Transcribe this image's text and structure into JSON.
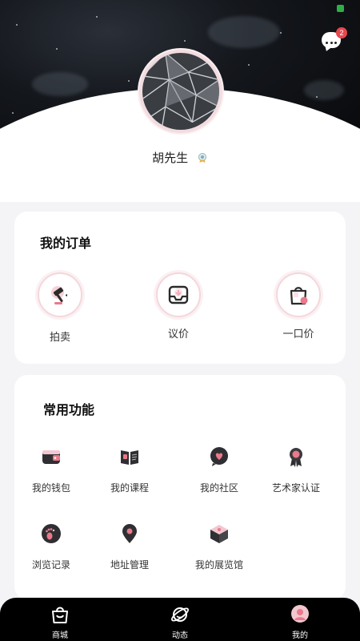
{
  "profile": {
    "name": "胡先生",
    "message_badge_count": "2"
  },
  "orders": {
    "title": "我的订单",
    "items": [
      {
        "label": "拍卖",
        "icon": "auction-gavel-icon"
      },
      {
        "label": "议价",
        "icon": "bargain-inbox-icon"
      },
      {
        "label": "一口价",
        "icon": "fixed-price-bag-icon"
      }
    ]
  },
  "functions": {
    "title": "常用功能",
    "items": [
      {
        "label": "我的钱包",
        "icon": "wallet-icon"
      },
      {
        "label": "我的课程",
        "icon": "book-icon"
      },
      {
        "label": "我的社区",
        "icon": "heart-chat-icon"
      },
      {
        "label": "艺术家认证",
        "icon": "award-medal-icon"
      },
      {
        "label": "浏览记录",
        "icon": "footprint-icon"
      },
      {
        "label": "地址管理",
        "icon": "location-pin-icon"
      },
      {
        "label": "我的展览馆",
        "icon": "cube-icon"
      }
    ]
  },
  "bottom_nav": {
    "items": [
      {
        "label": "商城",
        "icon": "shop-bag-icon"
      },
      {
        "label": "动态",
        "icon": "planet-icon"
      },
      {
        "label": "我的",
        "icon": "profile-icon",
        "active": true
      }
    ]
  },
  "colors": {
    "accent_pink": "#e9798b",
    "badge_red": "#e8474f",
    "nav_bg": "#000000",
    "page_bg": "#f4f3f6"
  }
}
